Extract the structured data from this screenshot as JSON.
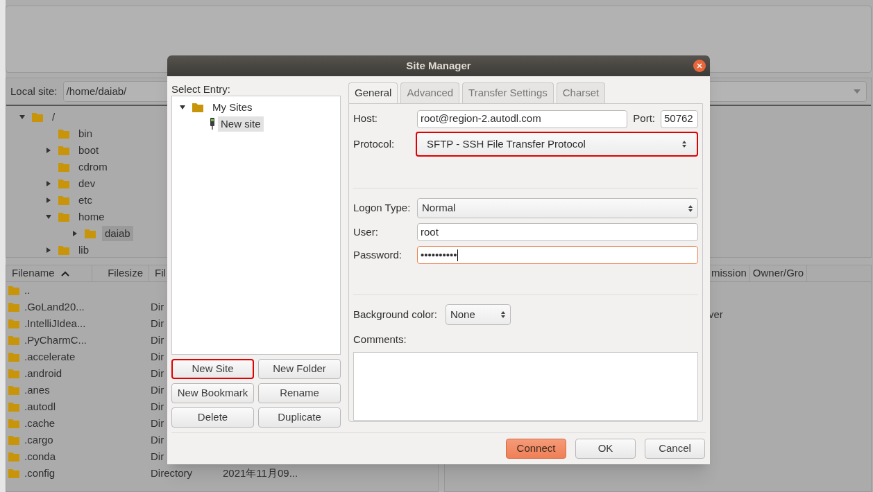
{
  "local_site": {
    "label": "Local site:",
    "value": "/home/daiab/"
  },
  "local_tree": [
    {
      "name": "/",
      "expandable": true,
      "expanded": true,
      "selected": false,
      "children": [
        {
          "name": "bin",
          "expandable": false,
          "selected": false
        },
        {
          "name": "boot",
          "expandable": true,
          "expanded": false,
          "selected": false
        },
        {
          "name": "cdrom",
          "expandable": false,
          "selected": false
        },
        {
          "name": "dev",
          "expandable": true,
          "expanded": false,
          "selected": false
        },
        {
          "name": "etc",
          "expandable": true,
          "expanded": false,
          "selected": false
        },
        {
          "name": "home",
          "expandable": true,
          "expanded": true,
          "selected": false,
          "children": [
            {
              "name": "daiab",
              "expandable": true,
              "expanded": false,
              "selected": true
            }
          ]
        },
        {
          "name": "lib",
          "expandable": true,
          "expanded": false,
          "selected": false
        }
      ]
    }
  ],
  "local_columns": [
    {
      "label": "Filename",
      "sorted": true
    },
    {
      "label": "Filesize"
    },
    {
      "label": "Fil"
    }
  ],
  "local_files": [
    {
      "name": ".."
    },
    {
      "name": ".GoLand20...",
      "type": "Dir"
    },
    {
      "name": ".IntelliJIdea...",
      "type": "Dir"
    },
    {
      "name": ".PyCharmC...",
      "type": "Dir"
    },
    {
      "name": ".accelerate",
      "type": "Dir"
    },
    {
      "name": ".android",
      "type": "Dir"
    },
    {
      "name": ".anes",
      "type": "Dir"
    },
    {
      "name": ".autodl",
      "type": "Dir"
    },
    {
      "name": ".cache",
      "type": "Dir"
    },
    {
      "name": ".cargo",
      "type": "Dir"
    },
    {
      "name": ".conda",
      "type": "Dir"
    },
    {
      "name": ".config",
      "type": "Directory",
      "modified": "2021年11月09..."
    }
  ],
  "remote_columns": [
    "mission",
    "Owner/Gro"
  ],
  "remote_message": "ver",
  "dialog": {
    "title": "Site Manager",
    "select_entry_label": "Select Entry:",
    "tree": [
      {
        "name": "My Sites",
        "expanded": true,
        "selected": false,
        "children": [
          {
            "name": "New site",
            "selected": true
          }
        ]
      }
    ],
    "entry_buttons": [
      {
        "label": "New Site",
        "highlighted": true
      },
      {
        "label": "New Folder",
        "highlighted": false
      },
      {
        "label": "New Bookmark",
        "highlighted": false
      },
      {
        "label": "Rename",
        "highlighted": false
      },
      {
        "label": "Delete",
        "highlighted": false
      },
      {
        "label": "Duplicate",
        "highlighted": false
      }
    ],
    "tabs": [
      {
        "label": "General",
        "selected": true
      },
      {
        "label": "Advanced",
        "selected": false
      },
      {
        "label": "Transfer Settings",
        "selected": false
      },
      {
        "label": "Charset",
        "selected": false
      }
    ],
    "host": {
      "label": "Host:",
      "value": "root@region-2.autodl.com"
    },
    "port": {
      "label": "Port:",
      "value": "50762"
    },
    "protocol": {
      "label": "Protocol:",
      "value": "SFTP - SSH File Transfer Protocol",
      "highlighted": true
    },
    "logon_type": {
      "label": "Logon Type:",
      "value": "Normal"
    },
    "user": {
      "label": "User:",
      "value": "root"
    },
    "password": {
      "label": "Password:",
      "value": "••••••••••",
      "focused": true
    },
    "background_color": {
      "label": "Background color:",
      "value": "None"
    },
    "comments": {
      "label": "Comments:"
    },
    "footer_buttons": [
      {
        "label": "Connect",
        "kind": "primary"
      },
      {
        "label": "OK",
        "kind": "normal"
      },
      {
        "label": "Cancel",
        "kind": "normal"
      }
    ]
  }
}
